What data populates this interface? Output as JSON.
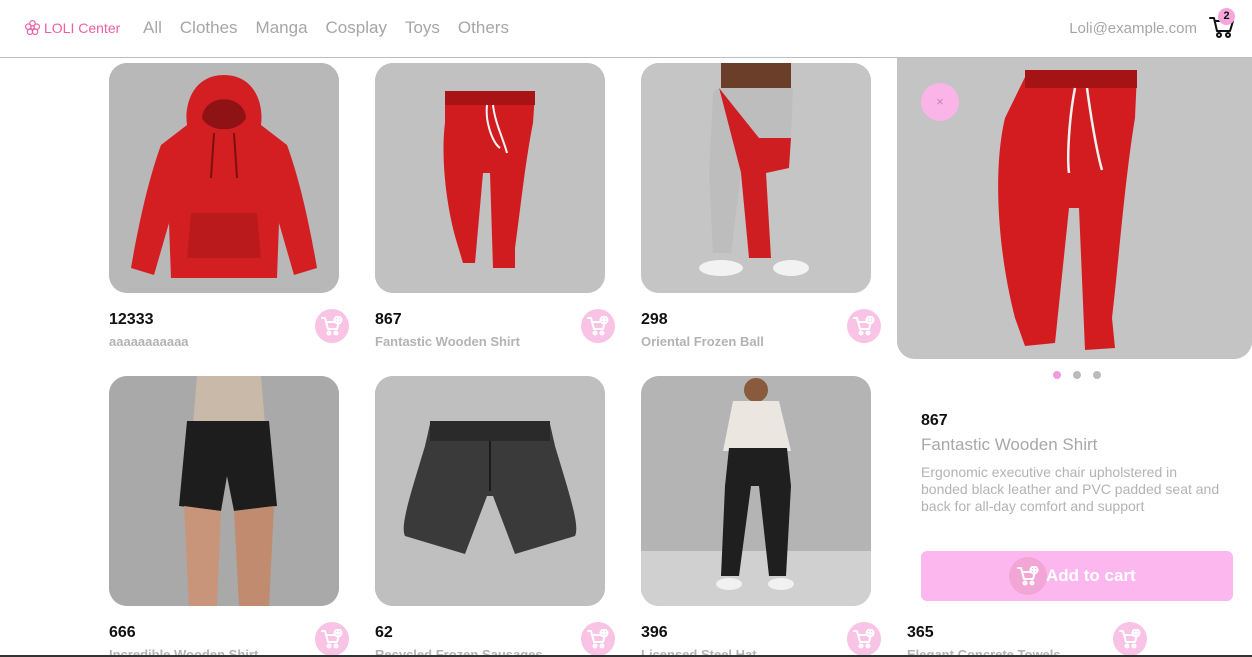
{
  "header": {
    "logo_text": "LOLI Center",
    "nav": [
      "All",
      "Clothes",
      "Manga",
      "Cosplay",
      "Toys",
      "Others"
    ],
    "user_email": "Loli@example.com",
    "cart_count": "2"
  },
  "products": [
    {
      "price": "12333",
      "name": "aaaaaaaaaaa",
      "image": "red-hoodie"
    },
    {
      "price": "867",
      "name": "Fantastic Wooden Shirt",
      "image": "red-sweatpants"
    },
    {
      "price": "298",
      "name": "Oriental Frozen Ball",
      "image": "red-grey-joggers"
    },
    {
      "price": "666",
      "name": "Incredible Wooden Shirt",
      "image": "black-shorts-model"
    },
    {
      "price": "62",
      "name": "Recycled Frozen Sausages",
      "image": "black-shorts"
    },
    {
      "price": "396",
      "name": "Licensed Steel Hat",
      "image": "black-joggers-model"
    },
    {
      "price": "365",
      "name": "Elegant Concrete Towels",
      "image": "none"
    }
  ],
  "detail": {
    "price": "867",
    "name": "Fantastic Wooden Shirt",
    "description": "Ergonomic executive chair upholstered in bonded black leather and PVC padded seat and back for all-day comfort and support",
    "add_label": "Add to cart",
    "close_label": "×",
    "slides": 3,
    "active_slide": 1
  },
  "colors": {
    "accent_pink": "#f8c3e5",
    "brand_pink": "#ec5fa6",
    "muted_text": "#a6a6a6"
  }
}
